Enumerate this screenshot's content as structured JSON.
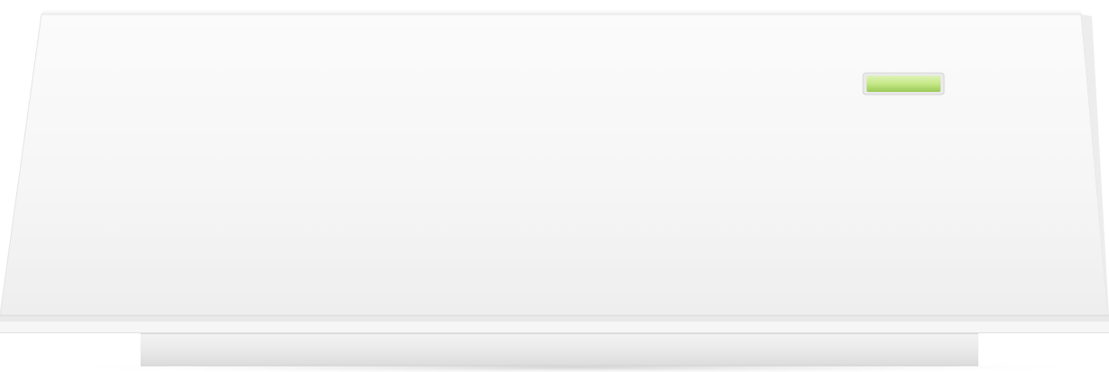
{
  "image": {
    "subject": "white-device-front-panel",
    "background_color": "#ffffff",
    "panel_color": "#f7f7f7",
    "base_color": "#ececec",
    "status_led": {
      "state": "on",
      "color": "#b5dc6e",
      "glow_color": "#dff3b8"
    }
  }
}
